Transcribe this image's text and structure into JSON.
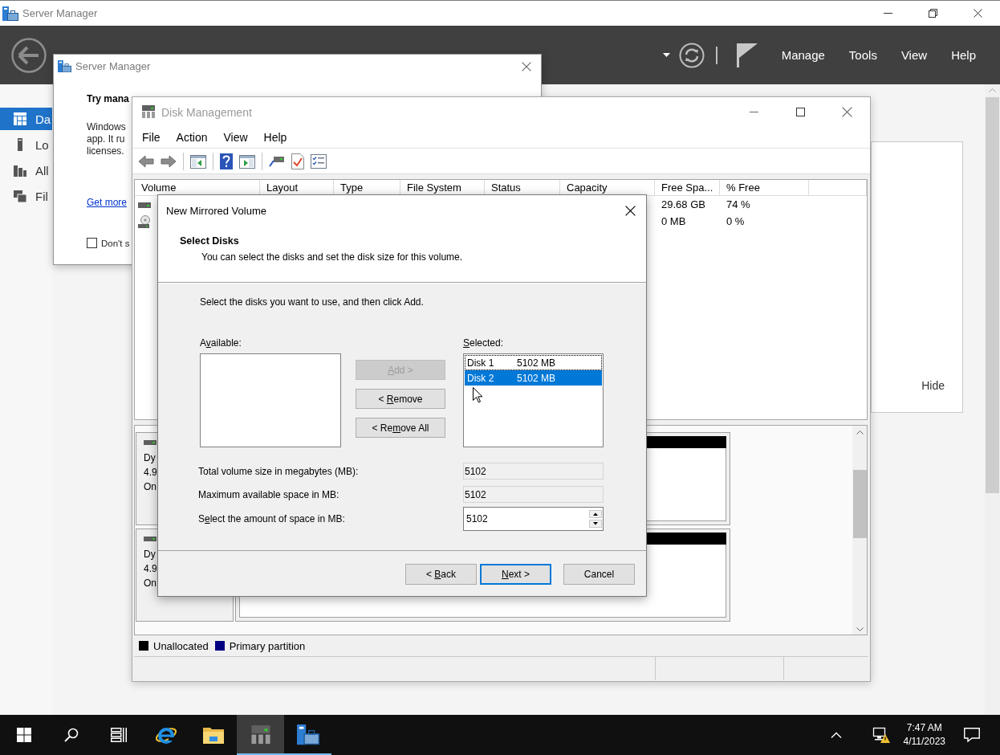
{
  "server_manager": {
    "title": "Server Manager",
    "menu": [
      "Manage",
      "Tools",
      "View",
      "Help"
    ],
    "sidebar": {
      "items": [
        {
          "label": "Da",
          "kind": "dashboard",
          "selected": true
        },
        {
          "label": "Lo",
          "kind": "local_server",
          "selected": false
        },
        {
          "label": "All",
          "kind": "all_servers",
          "selected": false
        },
        {
          "label": "Fil",
          "kind": "file_storage",
          "selected": false
        }
      ]
    },
    "welcome_tile": {
      "hide_link": "Hide"
    }
  },
  "notice_dialog": {
    "title": "Server Manager",
    "heading": "Try mana",
    "body_lines": [
      "Windows",
      "app. It ru",
      "licenses."
    ],
    "link": "Get more",
    "checkbox": {
      "label": "Don't s",
      "checked": false
    }
  },
  "disk_management": {
    "title": "Disk Management",
    "menu": [
      "File",
      "Action",
      "View",
      "Help"
    ],
    "volume_list": {
      "columns": [
        "Volume",
        "Layout",
        "Type",
        "File System",
        "Status",
        "Capacity",
        "Free Spa...",
        "% Free"
      ],
      "rows": [
        {
          "kind": "disk",
          "free_space": "29.68 GB",
          "percent_free": "74 %"
        },
        {
          "kind": "optical",
          "free_space": "0 MB",
          "percent_free": "0 %"
        }
      ]
    },
    "disks": [
      {
        "lines": [
          "Dy",
          "4.9",
          "On"
        ],
        "partition": {
          "color": "#000000"
        }
      },
      {
        "lines": [
          "Dy",
          "4.9",
          "On"
        ],
        "partition": {
          "color": "#000000"
        }
      }
    ],
    "legend": [
      {
        "label": "Unallocated",
        "color": "#000000"
      },
      {
        "label": "Primary partition",
        "color": "#000080"
      }
    ]
  },
  "mirrored_volume_wizard": {
    "title": "New Mirrored Volume",
    "heading": "Select Disks",
    "subheading": "You can select the disks and set the disk size for this volume.",
    "instruction": "Select the disks you want to use, and then click Add.",
    "available": {
      "label_start": "A",
      "access_key": "v",
      "label_end": "ailable:"
    },
    "move_buttons": [
      {
        "access_key": "A",
        "label_end": "dd >",
        "disabled": true
      },
      {
        "label_start": "< ",
        "access_key": "R",
        "label_end": "emove",
        "disabled": false
      },
      {
        "label_start": "< Re",
        "access_key": "m",
        "label_end": "ove All",
        "disabled": false
      }
    ],
    "selected_disks": {
      "access_key": "S",
      "label_end": "elected:",
      "items": [
        {
          "disk": "Disk 1",
          "size": "5102 MB",
          "selected": false,
          "focused": true
        },
        {
          "disk": "Disk 2",
          "size": "5102 MB",
          "selected": true,
          "focused": false
        }
      ]
    },
    "fields": [
      {
        "label": "Total volume size in megabytes (MB):",
        "value": "5102",
        "kind": "readonly"
      },
      {
        "label": "Maximum available space in MB:",
        "value": "5102",
        "kind": "readonly"
      },
      {
        "label_start": "S",
        "access_key": "e",
        "label_end": "lect the amount of space in MB:",
        "value": "5102",
        "kind": "spin"
      }
    ],
    "footer_buttons": [
      {
        "label_start": "< ",
        "access_key": "B",
        "label_end": "ack",
        "default": false
      },
      {
        "access_key": "N",
        "label_end": "ext >",
        "default": true
      },
      {
        "label": "Cancel",
        "default": false
      }
    ]
  },
  "taskbar": {
    "apps": [
      {
        "kind": "start",
        "selected": false,
        "running": false
      },
      {
        "kind": "search",
        "selected": false,
        "running": false
      },
      {
        "kind": "task_view",
        "selected": false,
        "running": false
      },
      {
        "kind": "browser",
        "selected": false,
        "running": false
      },
      {
        "kind": "file_explorer",
        "selected": false,
        "running": false
      },
      {
        "kind": "disk_management",
        "selected": true,
        "running": true
      },
      {
        "kind": "server_manager",
        "selected": false,
        "running": true
      }
    ],
    "clock": {
      "time": "7:47 AM",
      "date": "4/11/2023"
    }
  }
}
